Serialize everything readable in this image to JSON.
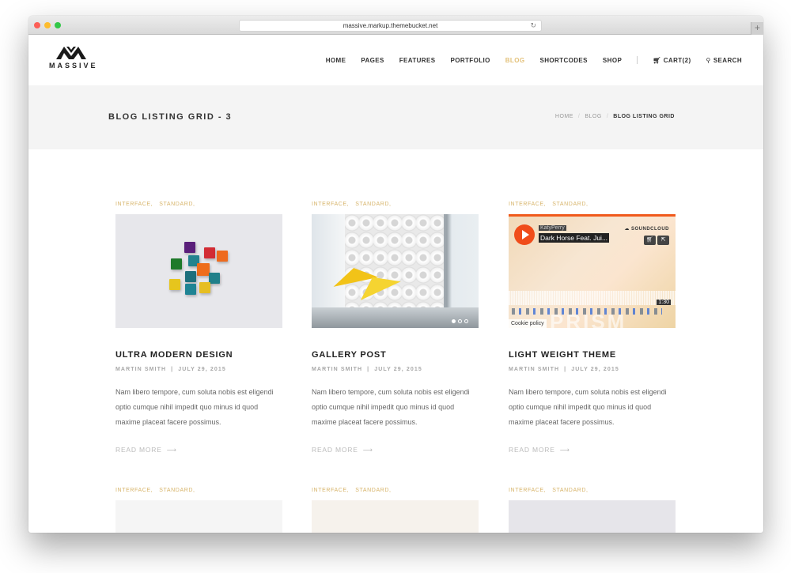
{
  "browser": {
    "url": "massive.markup.themebucket.net",
    "new_tab_icon": "plus-icon",
    "reload_icon": "reload-icon"
  },
  "header": {
    "logo_text": "MASSIVE",
    "nav": [
      {
        "label": "HOME",
        "active": false
      },
      {
        "label": "PAGES",
        "active": false
      },
      {
        "label": "FEATURES",
        "active": false
      },
      {
        "label": "PORTFOLIO",
        "active": false
      },
      {
        "label": "BLOG",
        "active": true
      },
      {
        "label": "SHORTCODES",
        "active": false
      },
      {
        "label": "SHOP",
        "active": false
      }
    ],
    "cart_label": "CART(2)",
    "cart_icon": "cart-icon",
    "search_label": "SEARCH",
    "search_icon": "search-icon",
    "accent_color": "#e3c17a"
  },
  "title_band": {
    "title": "BLOG LISTING GRID - 3",
    "breadcrumb": [
      "HOME",
      "BLOG",
      "BLOG LISTING GRID"
    ]
  },
  "posts": [
    {
      "categories": [
        "INTERFACE,",
        "STANDARD,"
      ],
      "title": "ULTRA MODERN DESIGN",
      "author": "MARTIN SMITH",
      "date": "JULY 29, 2015",
      "excerpt": "Nam libero tempore, cum soluta nobis est eligendi optio cumque nihil impedit quo minus id quod maxime placeat facere possimus.",
      "read_more": "READ MORE",
      "image": "colorful-cubes"
    },
    {
      "categories": [
        "INTERFACE,",
        "STANDARD,"
      ],
      "title": "GALLERY POST",
      "author": "MARTIN SMITH",
      "date": "JULY 29, 2015",
      "excerpt": "Nam libero tempore, cum soluta nobis est eligendi optio cumque nihil impedit quo minus id quod maxime placeat facere possimus.",
      "read_more": "READ MORE",
      "image": "modern-interior-gallery"
    },
    {
      "categories": [
        "INTERFACE,",
        "STANDARD,"
      ],
      "title": "LIGHT WEIGHT THEME",
      "author": "MARTIN SMITH",
      "date": "JULY 29, 2015",
      "excerpt": "Nam libero tempore, cum soluta nobis est eligendi optio cumque nihil impedit quo minus id quod maxime placeat facere possimus.",
      "read_more": "READ MORE",
      "image": "soundcloud-embed",
      "embed": {
        "artist": "KatyPerry",
        "track": "Dark Horse Feat. Jui...",
        "brand": "SOUNDCLOUD",
        "time": "1:30",
        "album_text": "PRISM",
        "cookie": "Cookie policy"
      }
    },
    {
      "categories": [
        "INTERFACE,",
        "STANDARD,"
      ]
    },
    {
      "categories": [
        "INTERFACE,",
        "STANDARD,"
      ]
    },
    {
      "categories": [
        "INTERFACE,",
        "STANDARD,"
      ]
    }
  ]
}
